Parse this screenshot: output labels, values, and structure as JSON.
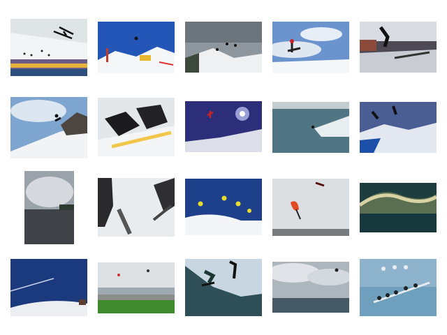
{
  "gallery": {
    "thumbnails": [
      {
        "icon": "ski-jump-photo"
      },
      {
        "icon": "ski-park-blue-sky-photo"
      },
      {
        "icon": "snow-jumps-cloudy-photo"
      },
      {
        "icon": "freestyle-skier-photo"
      },
      {
        "icon": "snowboard-rail-photo"
      },
      {
        "icon": "snowboard-cliff-jump-photo"
      },
      {
        "icon": "snowboard-boots-closeup-photo"
      },
      {
        "icon": "skier-night-sky-photo"
      },
      {
        "icon": "kitesurfer-sea-photo"
      },
      {
        "icon": "two-jumpers-mountain-photo"
      },
      {
        "icon": "lake-cloudy-sky-photo"
      },
      {
        "icon": "skis-in-snow-photo"
      },
      {
        "icon": "three-jumpers-yellow-photo"
      },
      {
        "icon": "kite-jump-beach-photo"
      },
      {
        "icon": "ocean-wave-photo"
      },
      {
        "icon": "snow-slope-jet-trail-photo"
      },
      {
        "icon": "beach-kites-photo"
      },
      {
        "icon": "snowboarder-silhouette-photo"
      },
      {
        "icon": "kitesurf-sea-clouds-photo"
      },
      {
        "icon": "seabirds-on-posts-photo"
      }
    ]
  }
}
